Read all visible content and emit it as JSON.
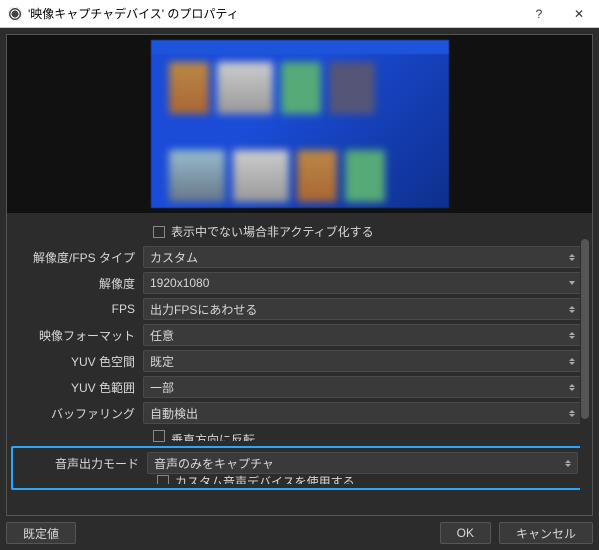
{
  "window": {
    "title": "'映像キャプチャデバイス' のプロパティ"
  },
  "checkboxes": {
    "deactivate_when_not_showing": "表示中でない場合非アクティブ化する",
    "flip_vertically": "垂直方向に反転",
    "use_custom_audio_device": "カスタム音声デバイスを使用する"
  },
  "rows": {
    "resolution_fps_type": {
      "label": "解像度/FPS タイプ",
      "value": "カスタム"
    },
    "resolution": {
      "label": "解像度",
      "value": "1920x1080"
    },
    "fps": {
      "label": "FPS",
      "value": "出力FPSにあわせる"
    },
    "video_format": {
      "label": "映像フォーマット",
      "value": "任意"
    },
    "yuv_color_space": {
      "label": "YUV 色空間",
      "value": "既定"
    },
    "yuv_color_range": {
      "label": "YUV 色範囲",
      "value": "一部"
    },
    "buffering": {
      "label": "バッファリング",
      "value": "自動検出"
    },
    "audio_output_mode": {
      "label": "音声出力モード",
      "value": "音声のみをキャプチャ"
    }
  },
  "buttons": {
    "defaults": "既定値",
    "ok": "OK",
    "cancel": "キャンセル"
  }
}
